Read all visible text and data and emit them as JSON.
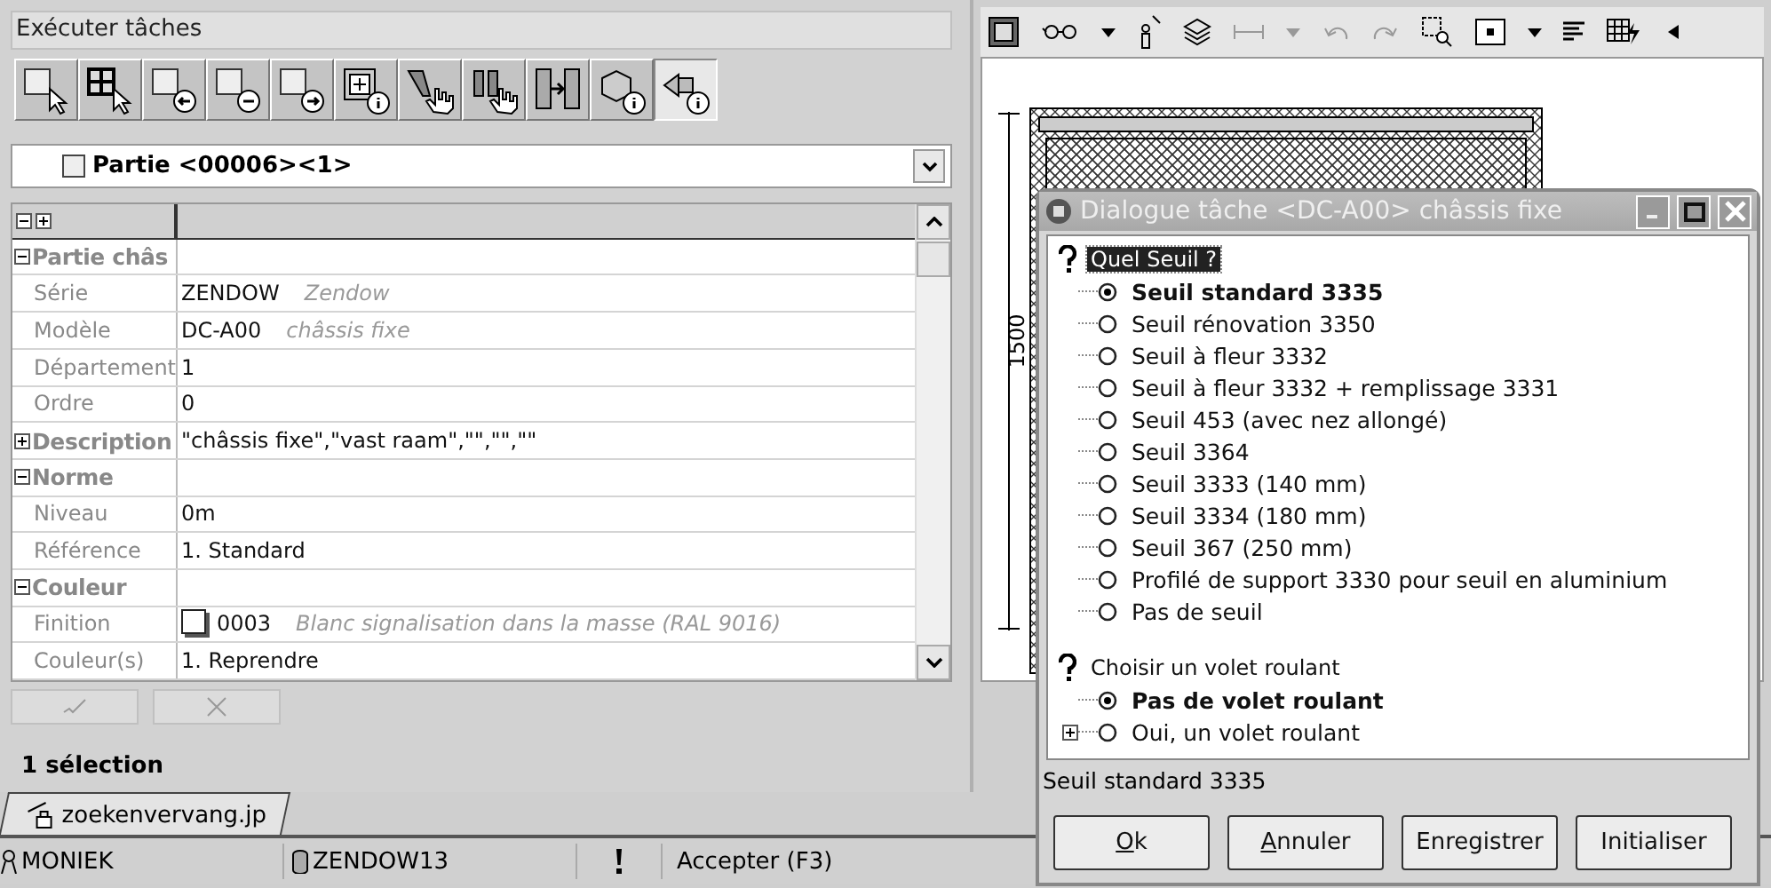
{
  "task_panel": {
    "title": "Exécuter tâches",
    "tools": [
      {
        "kind": "part-pointer",
        "selected": false
      },
      {
        "kind": "grid-pointer",
        "selected": false
      },
      {
        "kind": "part-left",
        "selected": false
      },
      {
        "kind": "part-minus",
        "selected": false
      },
      {
        "kind": "part-right",
        "selected": false
      },
      {
        "kind": "frame-info",
        "selected": false
      },
      {
        "kind": "hand-profile",
        "selected": false
      },
      {
        "kind": "hand-double",
        "selected": false
      },
      {
        "kind": "frame-arrow",
        "selected": false
      },
      {
        "kind": "cube-info",
        "selected": false
      },
      {
        "kind": "vector-info",
        "selected": true
      }
    ],
    "part_selector": {
      "checked": false,
      "label": "Partie <00006><1>"
    },
    "properties": [
      {
        "kind": "group",
        "label": "Partie châs",
        "expanded": true
      },
      {
        "kind": "property",
        "label": "Série",
        "value": "ZENDOW",
        "note": "Zendow"
      },
      {
        "kind": "property",
        "label": "Modèle",
        "value": "DC-A00",
        "note": "châssis fixe"
      },
      {
        "kind": "property",
        "label": "Département",
        "value": "1"
      },
      {
        "kind": "property",
        "label": "Ordre",
        "value": "0"
      },
      {
        "kind": "group",
        "label": "Description",
        "expanded": false,
        "value": "\"châssis fixe\",\"vast raam\",\"\",\"\",\"\""
      },
      {
        "kind": "group",
        "label": "Norme",
        "expanded": true
      },
      {
        "kind": "property",
        "label": "Niveau",
        "value": "0m"
      },
      {
        "kind": "property",
        "label": "Référence",
        "value": "1. Standard"
      },
      {
        "kind": "group",
        "label": "Couleur",
        "expanded": true
      },
      {
        "kind": "color",
        "label": "Finition",
        "value": "0003",
        "note": "Blanc signalisation dans la masse (RAL 9016)"
      },
      {
        "kind": "property",
        "label": "Couleur(s)",
        "value": "1. Reprendre"
      }
    ],
    "selection_count": "1 sélection"
  },
  "drawing": {
    "dimension": "1500"
  },
  "file_tab": {
    "label": "zoekenvervang.jp",
    "selected": true
  },
  "status_bar": {
    "user": "MONIEK",
    "database": "ZENDOW13",
    "hint": "Accepter (F3)"
  },
  "dialog": {
    "title": "Dialogue tâche <DC-A00> châssis fixe",
    "questions": [
      {
        "label": "Quel Seuil ?",
        "selected": true,
        "options": [
          {
            "label": "Seuil standard 3335",
            "selected": true
          },
          {
            "label": "Seuil rénovation 3350",
            "selected": false
          },
          {
            "label": "Seuil à fleur 3332",
            "selected": false
          },
          {
            "label": "Seuil à fleur 3332 + remplissage 3331",
            "selected": false
          },
          {
            "label": "Seuil 453 (avec nez allongé)",
            "selected": false
          },
          {
            "label": "Seuil 3364",
            "selected": false
          },
          {
            "label": "Seuil 3333 (140 mm)",
            "selected": false
          },
          {
            "label": "Seuil 3334 (180 mm)",
            "selected": false
          },
          {
            "label": "Seuil 367 (250 mm)",
            "selected": false
          },
          {
            "label": "Profilé de support 3330 pour seuil en aluminium",
            "selected": false
          },
          {
            "label": "Pas de seuil",
            "selected": false
          }
        ]
      },
      {
        "label": "Choisir un volet roulant",
        "selected": false,
        "options": [
          {
            "label": "Pas de volet roulant",
            "selected": true,
            "expandable": false
          },
          {
            "label": "Oui, un volet roulant",
            "selected": false,
            "expandable": true
          }
        ]
      }
    ],
    "status": "Seuil standard 3335",
    "buttons": [
      {
        "label": "Ok",
        "mnemonic": true
      },
      {
        "label": "Annuler",
        "mnemonic": true
      },
      {
        "label": "Enregistrer",
        "mnemonic": false
      },
      {
        "label": "Initialiser",
        "mnemonic": false
      }
    ]
  }
}
